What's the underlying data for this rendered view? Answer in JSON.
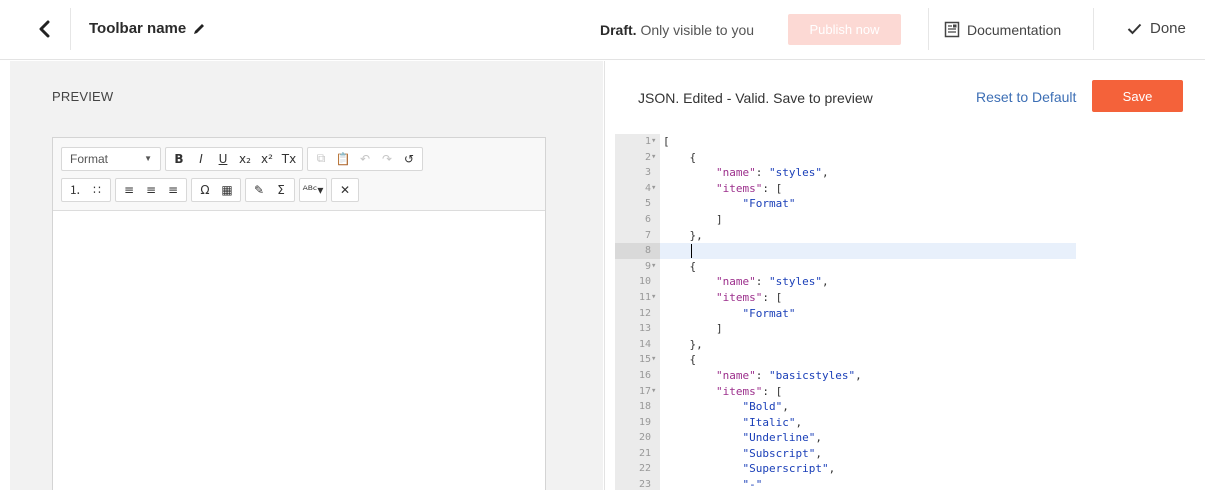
{
  "header": {
    "toolbar_name": "Toolbar name",
    "draft_strong": "Draft.",
    "draft_rest": "Only visible to you",
    "publish_label": "Publish now",
    "documentation_label": "Documentation",
    "done_label": "Done"
  },
  "preview": {
    "label": "PREVIEW",
    "format_label": "Format"
  },
  "json_panel": {
    "status": "JSON. Edited - Valid. Save to preview",
    "reset_label": "Reset to Default",
    "save_label": "Save"
  },
  "colors": {
    "save_bg": "#f4623a",
    "publish_bg_disabled": "#fcd9d4",
    "link": "#3d6fb5",
    "json_key": "#9c2f8c",
    "json_string": "#1a3fb8"
  },
  "code_lines": [
    {
      "n": "1",
      "fold": true,
      "parts": [
        [
          "p",
          "["
        ]
      ]
    },
    {
      "n": "2",
      "fold": true,
      "parts": [
        [
          "p",
          "    {"
        ]
      ]
    },
    {
      "n": "3",
      "fold": false,
      "parts": [
        [
          "p",
          "        "
        ],
        [
          "k",
          "\"name\""
        ],
        [
          "p",
          ": "
        ],
        [
          "s",
          "\"styles\""
        ],
        [
          "p",
          ","
        ]
      ]
    },
    {
      "n": "4",
      "fold": true,
      "parts": [
        [
          "p",
          "        "
        ],
        [
          "k",
          "\"items\""
        ],
        [
          "p",
          ": ["
        ]
      ]
    },
    {
      "n": "5",
      "fold": false,
      "parts": [
        [
          "p",
          "            "
        ],
        [
          "s",
          "\"Format\""
        ]
      ]
    },
    {
      "n": "6",
      "fold": false,
      "parts": [
        [
          "p",
          "        ]"
        ]
      ]
    },
    {
      "n": "7",
      "fold": false,
      "parts": [
        [
          "p",
          "    },"
        ]
      ]
    },
    {
      "n": "8",
      "fold": false,
      "active": true,
      "parts": [
        [
          "p",
          ""
        ]
      ]
    },
    {
      "n": "9",
      "fold": true,
      "parts": [
        [
          "p",
          "    {"
        ]
      ]
    },
    {
      "n": "10",
      "fold": false,
      "parts": [
        [
          "p",
          "        "
        ],
        [
          "k",
          "\"name\""
        ],
        [
          "p",
          ": "
        ],
        [
          "s",
          "\"styles\""
        ],
        [
          "p",
          ","
        ]
      ]
    },
    {
      "n": "11",
      "fold": true,
      "parts": [
        [
          "p",
          "        "
        ],
        [
          "k",
          "\"items\""
        ],
        [
          "p",
          ": ["
        ]
      ]
    },
    {
      "n": "12",
      "fold": false,
      "parts": [
        [
          "p",
          "            "
        ],
        [
          "s",
          "\"Format\""
        ]
      ]
    },
    {
      "n": "13",
      "fold": false,
      "parts": [
        [
          "p",
          "        ]"
        ]
      ]
    },
    {
      "n": "14",
      "fold": false,
      "parts": [
        [
          "p",
          "    },"
        ]
      ]
    },
    {
      "n": "15",
      "fold": true,
      "parts": [
        [
          "p",
          "    {"
        ]
      ]
    },
    {
      "n": "16",
      "fold": false,
      "parts": [
        [
          "p",
          "        "
        ],
        [
          "k",
          "\"name\""
        ],
        [
          "p",
          ": "
        ],
        [
          "s",
          "\"basicstyles\""
        ],
        [
          "p",
          ","
        ]
      ]
    },
    {
      "n": "17",
      "fold": true,
      "parts": [
        [
          "p",
          "        "
        ],
        [
          "k",
          "\"items\""
        ],
        [
          "p",
          ": ["
        ]
      ]
    },
    {
      "n": "18",
      "fold": false,
      "parts": [
        [
          "p",
          "            "
        ],
        [
          "s",
          "\"Bold\""
        ],
        [
          "p",
          ","
        ]
      ]
    },
    {
      "n": "19",
      "fold": false,
      "parts": [
        [
          "p",
          "            "
        ],
        [
          "s",
          "\"Italic\""
        ],
        [
          "p",
          ","
        ]
      ]
    },
    {
      "n": "20",
      "fold": false,
      "parts": [
        [
          "p",
          "            "
        ],
        [
          "s",
          "\"Underline\""
        ],
        [
          "p",
          ","
        ]
      ]
    },
    {
      "n": "21",
      "fold": false,
      "parts": [
        [
          "p",
          "            "
        ],
        [
          "s",
          "\"Subscript\""
        ],
        [
          "p",
          ","
        ]
      ]
    },
    {
      "n": "22",
      "fold": false,
      "parts": [
        [
          "p",
          "            "
        ],
        [
          "s",
          "\"Superscript\""
        ],
        [
          "p",
          ","
        ]
      ]
    },
    {
      "n": "23",
      "fold": false,
      "parts": [
        [
          "p",
          "            "
        ],
        [
          "s",
          "\"-\""
        ]
      ]
    }
  ],
  "editor_toolbar": {
    "row1": [
      {
        "name": "bold-button",
        "glyph": "B",
        "disabled": false
      },
      {
        "name": "italic-button",
        "glyph": "I",
        "disabled": false
      },
      {
        "name": "underline-button",
        "glyph": "U",
        "disabled": false
      },
      {
        "name": "subscript-button",
        "glyph": "x₂",
        "disabled": false
      },
      {
        "name": "superscript-button",
        "glyph": "x²",
        "disabled": false
      },
      {
        "name": "remove-format-button",
        "glyph": "Tx",
        "disabled": false
      }
    ],
    "row1b": [
      {
        "name": "copy-button",
        "glyph": "⧉",
        "disabled": true
      },
      {
        "name": "paste-button",
        "glyph": "📋",
        "disabled": false
      },
      {
        "name": "undo-button",
        "glyph": "↶",
        "disabled": true
      },
      {
        "name": "redo-button",
        "glyph": "↷",
        "disabled": true
      },
      {
        "name": "source-button",
        "glyph": "↺",
        "disabled": false
      }
    ],
    "row2a": [
      {
        "name": "numbered-list-button",
        "glyph": "⒈",
        "disabled": false
      },
      {
        "name": "bulleted-list-button",
        "glyph": "∷",
        "disabled": false
      }
    ],
    "row2b": [
      {
        "name": "align-left-button",
        "glyph": "≡",
        "disabled": false
      },
      {
        "name": "align-center-button",
        "glyph": "≡",
        "disabled": false
      },
      {
        "name": "align-right-button",
        "glyph": "≡",
        "disabled": false
      }
    ],
    "row2c": [
      {
        "name": "special-char-button",
        "glyph": "Ω",
        "disabled": false
      },
      {
        "name": "table-button",
        "glyph": "▦",
        "disabled": false
      }
    ],
    "row2d": [
      {
        "name": "pen-button",
        "glyph": "✎",
        "disabled": false
      },
      {
        "name": "sigma-button",
        "glyph": "Σ",
        "disabled": false
      }
    ],
    "row2e": [
      {
        "name": "spellcheck-button",
        "glyph": "ᴬᴮᶜ▾",
        "disabled": false
      }
    ],
    "row2f": [
      {
        "name": "maximize-button",
        "glyph": "✕",
        "disabled": false
      }
    ]
  }
}
